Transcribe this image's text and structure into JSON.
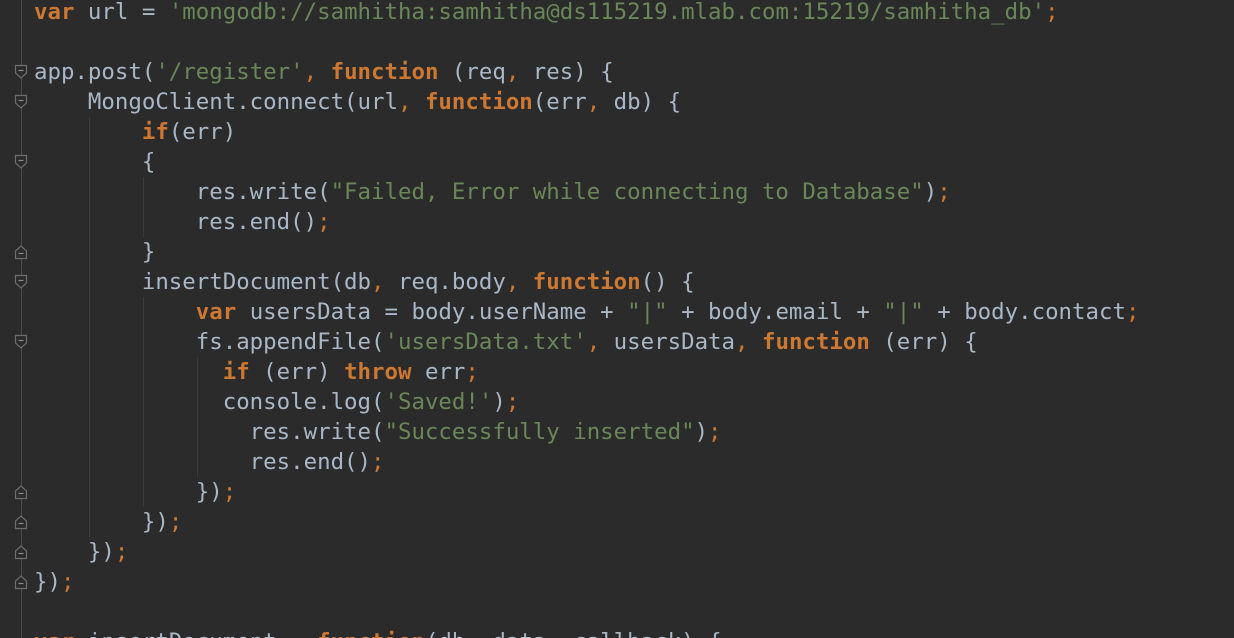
{
  "editor": {
    "language": "javascript",
    "theme_colors": {
      "background": "#2b2b2b",
      "default_text": "#a9b7c6",
      "keyword": "#cc7832",
      "string": "#6a8759",
      "gutter_line": "#4b4b4b"
    },
    "lines": [
      {
        "tokens": [
          [
            "kw",
            "var"
          ],
          [
            "t",
            " url = "
          ],
          [
            "str",
            "'mongodb://samhitha:samhitha@ds115219.mlab.com:15219/samhitha_db'"
          ],
          [
            "pun",
            ";"
          ]
        ]
      },
      {
        "tokens": []
      },
      {
        "tokens": [
          [
            "t",
            "app.post("
          ],
          [
            "str",
            "'/register'"
          ],
          [
            "pun",
            ", "
          ],
          [
            "kw",
            "function"
          ],
          [
            "t",
            " (req"
          ],
          [
            "pun",
            ","
          ],
          [
            "t",
            " res) {"
          ]
        ]
      },
      {
        "tokens": [
          [
            "t",
            "    MongoClient.connect(url"
          ],
          [
            "pun",
            ", "
          ],
          [
            "kw",
            "function"
          ],
          [
            "t",
            "(err"
          ],
          [
            "pun",
            ","
          ],
          [
            "t",
            " db) {"
          ]
        ]
      },
      {
        "tokens": [
          [
            "t",
            "        "
          ],
          [
            "kw",
            "if"
          ],
          [
            "t",
            "(err)"
          ]
        ]
      },
      {
        "tokens": [
          [
            "t",
            "        {"
          ]
        ]
      },
      {
        "tokens": [
          [
            "t",
            "            res.write("
          ],
          [
            "str",
            "\"Failed, Error while connecting to Database\""
          ],
          [
            "t",
            ")"
          ],
          [
            "pun",
            ";"
          ]
        ]
      },
      {
        "tokens": [
          [
            "t",
            "            res.end()"
          ],
          [
            "pun",
            ";"
          ]
        ]
      },
      {
        "tokens": [
          [
            "t",
            "        }"
          ]
        ]
      },
      {
        "tokens": [
          [
            "t",
            "        insertDocument(db"
          ],
          [
            "pun",
            ","
          ],
          [
            "t",
            " req.body"
          ],
          [
            "pun",
            ", "
          ],
          [
            "kw",
            "function"
          ],
          [
            "t",
            "() {"
          ]
        ]
      },
      {
        "tokens": [
          [
            "t",
            "            "
          ],
          [
            "kw",
            "var"
          ],
          [
            "t",
            " usersData = body.userName + "
          ],
          [
            "str",
            "\"|\""
          ],
          [
            "t",
            " + body.email + "
          ],
          [
            "str",
            "\"|\""
          ],
          [
            "t",
            " + body.contact"
          ],
          [
            "pun",
            ";"
          ]
        ]
      },
      {
        "tokens": [
          [
            "t",
            "            fs.appendFile("
          ],
          [
            "str",
            "'usersData.txt'"
          ],
          [
            "pun",
            ","
          ],
          [
            "t",
            " usersData"
          ],
          [
            "pun",
            ", "
          ],
          [
            "kw",
            "function"
          ],
          [
            "t",
            " (err) {"
          ]
        ]
      },
      {
        "tokens": [
          [
            "t",
            "              "
          ],
          [
            "kw",
            "if"
          ],
          [
            "t",
            " (err) "
          ],
          [
            "kw",
            "throw"
          ],
          [
            "t",
            " err"
          ],
          [
            "pun",
            ";"
          ]
        ]
      },
      {
        "tokens": [
          [
            "t",
            "              console.log("
          ],
          [
            "str",
            "'Saved!'"
          ],
          [
            "t",
            ")"
          ],
          [
            "pun",
            ";"
          ]
        ]
      },
      {
        "tokens": [
          [
            "t",
            "                res.write("
          ],
          [
            "str",
            "\"Successfully inserted\""
          ],
          [
            "t",
            ")"
          ],
          [
            "pun",
            ";"
          ]
        ]
      },
      {
        "tokens": [
          [
            "t",
            "                res.end()"
          ],
          [
            "pun",
            ";"
          ]
        ]
      },
      {
        "tokens": [
          [
            "t",
            "            })"
          ],
          [
            "pun",
            ";"
          ]
        ]
      },
      {
        "tokens": [
          [
            "t",
            "        })"
          ],
          [
            "pun",
            ";"
          ]
        ]
      },
      {
        "tokens": [
          [
            "t",
            "    })"
          ],
          [
            "pun",
            ";"
          ]
        ]
      },
      {
        "tokens": [
          [
            "t",
            "})"
          ],
          [
            "pun",
            ";"
          ]
        ]
      },
      {
        "tokens": []
      },
      {
        "tokens": [
          [
            "kw",
            "var"
          ],
          [
            "t",
            " insertDocument = "
          ],
          [
            "kw",
            "function"
          ],
          [
            "t",
            "(db"
          ],
          [
            "pun",
            ","
          ],
          [
            "t",
            " data"
          ],
          [
            "pun",
            ","
          ],
          [
            "t",
            " callback) {"
          ]
        ]
      }
    ],
    "fold_markers": [
      {
        "line": 2,
        "icon": "fold-open-icon"
      },
      {
        "line": 3,
        "icon": "fold-open-icon"
      },
      {
        "line": 5,
        "icon": "fold-open-icon"
      },
      {
        "line": 8,
        "icon": "fold-close-icon"
      },
      {
        "line": 9,
        "icon": "fold-open-icon"
      },
      {
        "line": 11,
        "icon": "fold-open-icon"
      },
      {
        "line": 16,
        "icon": "fold-close-icon"
      },
      {
        "line": 17,
        "icon": "fold-close-icon"
      },
      {
        "line": 18,
        "icon": "fold-close-icon"
      },
      {
        "line": 19,
        "icon": "fold-close-icon"
      }
    ]
  }
}
